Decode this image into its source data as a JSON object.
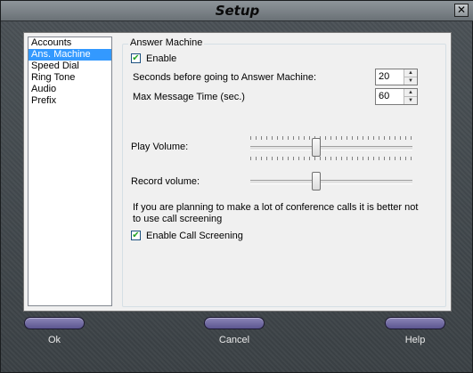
{
  "window": {
    "title": "Setup"
  },
  "sidebar": {
    "items": [
      {
        "label": "Accounts",
        "selected": false
      },
      {
        "label": "Ans. Machine",
        "selected": true
      },
      {
        "label": "Speed Dial",
        "selected": false
      },
      {
        "label": "Ring Tone",
        "selected": false
      },
      {
        "label": "Audio",
        "selected": false
      },
      {
        "label": "Prefix",
        "selected": false
      }
    ]
  },
  "answer_machine": {
    "group_title": "Answer Machine",
    "enable_label": "Enable",
    "enable_checked": true,
    "seconds_label": "Seconds before going to Answer Machine:",
    "seconds_value": "20",
    "max_time_label": "Max Message Time (sec.)",
    "max_time_value": "60",
    "play_volume_label": "Play Volume:",
    "play_volume_level": 0.4,
    "record_volume_label": "Record volume:",
    "record_volume_level": 0.4,
    "screening_note": "If you are planning to make a lot of conference calls it is better not to use call screening",
    "call_screening_label": "Enable Call Screening",
    "call_screening_checked": true
  },
  "buttons": {
    "ok_label": "Ok",
    "cancel_label": "Cancel",
    "help_label": "Help"
  },
  "colors": {
    "selection": "#3399ff",
    "button_fill": "#6e68a3"
  }
}
